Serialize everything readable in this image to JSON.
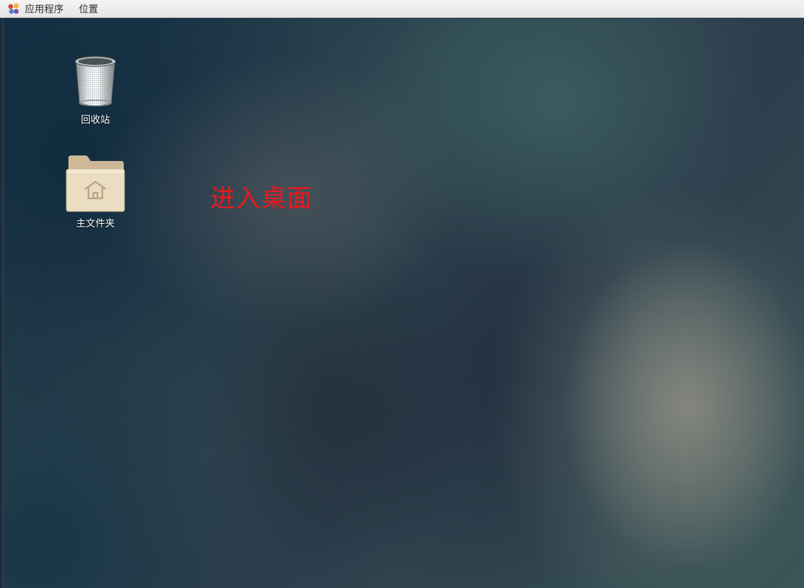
{
  "top_panel": {
    "applications_label": "应用程序",
    "applications_icon": "foot-logo-icon",
    "places_label": "位置"
  },
  "desktop": {
    "icons": [
      {
        "label": "回收站",
        "icon": "trash-icon"
      },
      {
        "label": "主文件夹",
        "icon": "home-folder-icon"
      }
    ],
    "annotation": "进入桌面",
    "annotation_color": "#e8191e"
  }
}
